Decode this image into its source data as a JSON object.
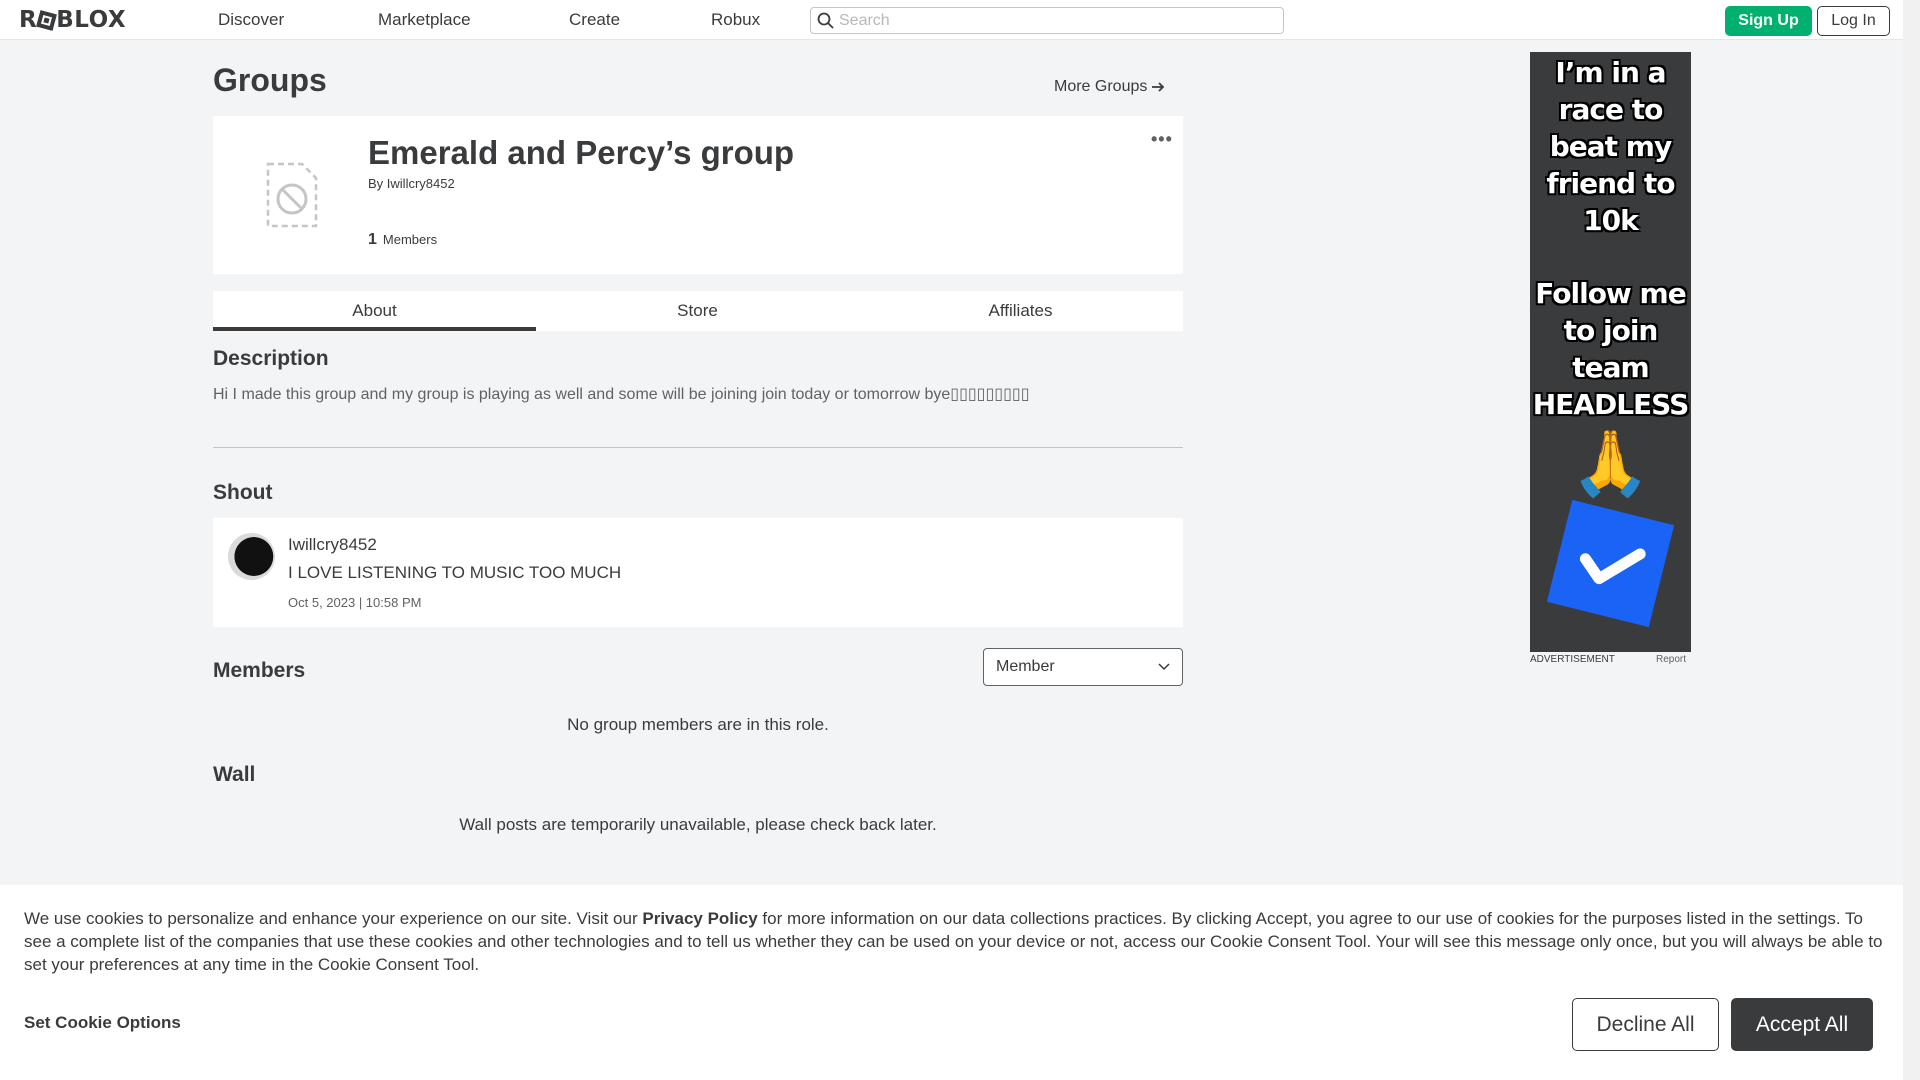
{
  "header": {
    "logo": "ROBLOX",
    "nav": [
      "Discover",
      "Marketplace",
      "Create",
      "Robux"
    ],
    "search_placeholder": "Search",
    "signup_label": "Sign Up",
    "login_label": "Log In"
  },
  "page": {
    "title": "Groups",
    "more_groups_label": "More Groups"
  },
  "group": {
    "name": "Emerald and Percy’s group",
    "by_prefix": "By",
    "owner": "Iwillcry8452",
    "member_count": "1",
    "members_label": "Members"
  },
  "tabs": [
    "About",
    "Store",
    "Affiliates"
  ],
  "description": {
    "heading": "Description",
    "text": "Hi I made this group and my group is playing as well and some will be joining join today or tomorrow bye▯▯▯▯▯▯▯▯▯"
  },
  "shout": {
    "heading": "Shout",
    "author": "Iwillcry8452",
    "body": "I LOVE LISTENING TO MUSIC TOO MUCH",
    "date": "Oct 5, 2023 | 10:58 PM"
  },
  "members": {
    "heading": "Members",
    "role_selected": "Member",
    "empty_message": "No group members are in this role."
  },
  "wall": {
    "heading": "Wall",
    "message": "Wall posts are temporarily unavailable, please check back later."
  },
  "ad": {
    "text1": "I’m in a race to beat my friend to 10k",
    "text2": "Follow me to join team HEADLESS",
    "label": "ADVERTISEMENT",
    "report": "Report"
  },
  "cookie": {
    "text_before": "We use cookies to personalize and enhance your experience on our site. Visit our ",
    "privacy_link": "Privacy Policy",
    "text_after": " for more information on our data collections practices. By clicking Accept, you agree to our use of cookies for the purposes listed in the settings. To see a complete list of the companies that use these cookies and other technologies and to tell us whether they can be used on your device or not, access our Cookie Consent Tool. Your will see this message only once, but you will always be able to set your preferences at any time in the Cookie Consent Tool.",
    "options_label": "Set Cookie Options",
    "decline_label": "Decline All",
    "accept_label": "Accept All"
  },
  "colors": {
    "signup_green": "#00b06f",
    "background": "#f2f4f5",
    "text_dark": "#393b3d",
    "ad_check_blue": "#1a63f5"
  }
}
